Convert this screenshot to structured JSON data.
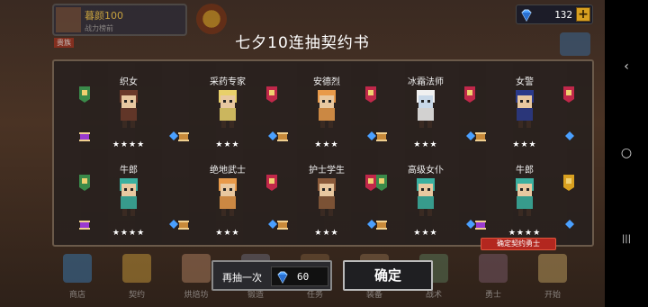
{
  "header": {
    "player_name": "暮颜100",
    "player_sub": "战力榜前",
    "player_tag": "贵族",
    "gems": "132",
    "plus_label": "+"
  },
  "dialog": {
    "title": "七夕10连抽契约书",
    "confirm_tag": "确定契约勇士",
    "cards": [
      {
        "name": "织女",
        "stars": "★★★★",
        "sprite_color": "#e8c8a0",
        "hair": "#6b3a2a",
        "item": "purple-scroll",
        "item_icon": "gem-icon",
        "badge": "green"
      },
      {
        "name": "采药专家",
        "stars": "★★★",
        "sprite_color": "#e8c8a0",
        "hair": "#e8d06a",
        "item": "orange-scroll",
        "item_icon": "potion-icon",
        "badge": "red"
      },
      {
        "name": "安德烈",
        "stars": "★★★",
        "sprite_color": "#e8c8a0",
        "hair": "#e89a4a",
        "item": "orange-scroll",
        "item_icon": "gem-icon",
        "badge": "red"
      },
      {
        "name": "冰霜法师",
        "stars": "★★★",
        "sprite_color": "#c8d8e8",
        "hair": "#f0f0f0",
        "item": "orange-scroll",
        "item_icon": "wand-icon",
        "badge": "red"
      },
      {
        "name": "女警",
        "stars": "★★★",
        "sprite_color": "#e8c8a0",
        "hair": "#2a3a8a",
        "item": "orange-scroll",
        "item_icon": "baton-icon",
        "badge": "red"
      },
      {
        "name": "牛郎",
        "stars": "★★★★",
        "sprite_color": "#e8c8a0",
        "hair": "#3ab0a0",
        "item": "purple-scroll",
        "item_icon": "star-icon",
        "badge": "green"
      },
      {
        "name": "绝地武士",
        "stars": "★★★",
        "sprite_color": "#e8c8a0",
        "hair": "#e89a4a",
        "item": "orange-scroll",
        "item_icon": "sword-icon",
        "badge": "red"
      },
      {
        "name": "护士学生",
        "stars": "★★★",
        "sprite_color": "#e8c8a0",
        "hair": "#8a5a3a",
        "item": "orange-scroll",
        "item_icon": "syringe-icon",
        "badge": "red"
      },
      {
        "name": "高级女仆",
        "stars": "★★★",
        "sprite_color": "#e8c8a0",
        "hair": "#3ab0a0",
        "item": "orange-scroll",
        "item_icon": "fan-icon",
        "badge": "green"
      },
      {
        "name": "牛郎",
        "stars": "★★★★",
        "sprite_color": "#e8c8a0",
        "hair": "#3ab0a0",
        "item": "purple-scroll",
        "item_icon": "star-icon",
        "badge": "gold"
      }
    ]
  },
  "actions": {
    "redraw_label": "再抽一次",
    "redraw_cost": "60",
    "confirm_label": "确定"
  },
  "nav": {
    "items": [
      {
        "label": "商店",
        "color": "#3a7ab0"
      },
      {
        "label": "契约",
        "color": "#c89a3a"
      },
      {
        "label": "烘焙坊",
        "color": "#b08060"
      },
      {
        "label": "锻造",
        "color": "#6a6a7a"
      },
      {
        "label": "任务",
        "color": "#7a5a3a"
      },
      {
        "label": "装备",
        "color": "#8a6a4a"
      },
      {
        "label": "战术",
        "color": "#5a7a5a"
      },
      {
        "label": "勇士",
        "color": "#7a5a6a"
      },
      {
        "label": "开始",
        "color": "#c0a060"
      }
    ]
  },
  "system": {
    "back_icon": "‹",
    "home_icon": "○",
    "recents_icon": "|||"
  },
  "colors": {
    "gem": "#4aa0ff",
    "confirm_tag": "#b3271f",
    "badge_red": "#c0284a",
    "badge_green": "#3a8a4a",
    "badge_gold": "#d8a020"
  }
}
